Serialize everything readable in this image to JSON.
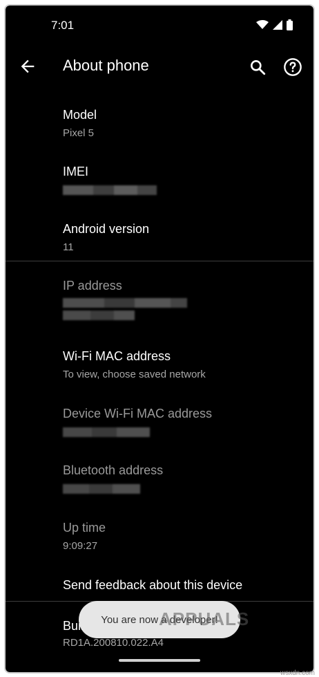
{
  "status": {
    "time": "7:01",
    "icons": [
      "wifi-icon",
      "signal-icon",
      "battery-icon"
    ]
  },
  "appbar": {
    "title": "About phone",
    "back_icon": "arrow-back-icon",
    "search_icon": "search-icon",
    "help_icon": "help-icon"
  },
  "items": [
    {
      "title": "Model",
      "summary": "Pixel 5"
    },
    {
      "title": "IMEI",
      "summary": ""
    },
    {
      "title": "Android version",
      "summary": "11"
    },
    {
      "title": "IP address",
      "summary": ""
    },
    {
      "title": "Wi-Fi MAC address",
      "summary": "To view, choose saved network"
    },
    {
      "title": "Device Wi-Fi MAC address",
      "summary": ""
    },
    {
      "title": "Bluetooth address",
      "summary": ""
    },
    {
      "title": "Up time",
      "summary": "9:09:27"
    },
    {
      "title": "Send feedback about this device",
      "summary": ""
    },
    {
      "title": "Build number",
      "summary": "RD1A.200810.022.A4"
    }
  ],
  "toast": {
    "message": "You are now a developer!"
  },
  "watermark": "APPUALS",
  "site_credit": "wsxdn.com",
  "colors": {
    "background": "#000000",
    "text_primary": "#ffffff",
    "text_secondary": "#a7a7a7",
    "toast_bg": "#e6e6e6"
  }
}
